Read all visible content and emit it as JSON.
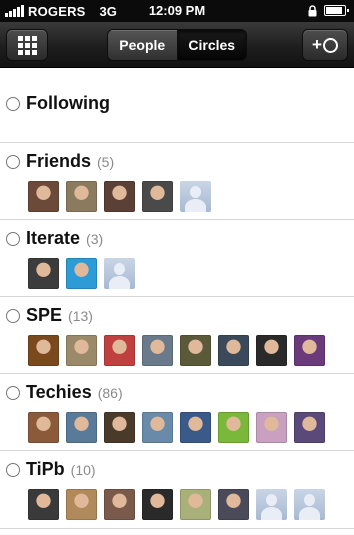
{
  "status_bar": {
    "carrier": "ROGERS",
    "network": "3G",
    "time": "12:09 PM"
  },
  "nav": {
    "segments": [
      "People",
      "Circles"
    ],
    "selected_segment": "Circles",
    "add_button": "+O"
  },
  "circles": [
    {
      "name": "Following",
      "count": "",
      "avatars": []
    },
    {
      "name": "Friends",
      "count": "(5)",
      "avatars": [
        "#6b4a3a",
        "#8a7a5e",
        "#5a4035",
        "#4a4a4a",
        "placeholder"
      ]
    },
    {
      "name": "Iterate",
      "count": "(3)",
      "avatars": [
        "#3c3c3c",
        "#2d9bd6",
        "placeholder"
      ]
    },
    {
      "name": "SPE",
      "count": "(13)",
      "avatars": [
        "#7a4a1e",
        "#9a8a6a",
        "#c04040",
        "#6a7a8a",
        "#5a5a3a",
        "#3a4a5a",
        "#2a2a2a",
        "#6a3a7a"
      ]
    },
    {
      "name": "Techies",
      "count": "(86)",
      "avatars": [
        "#8a5a3a",
        "#5a7a9a",
        "#4a3a2a",
        "#6a8aaa",
        "#3a5a8a",
        "#7ab83a",
        "#c9a0c0",
        "#5a4a7a"
      ]
    },
    {
      "name": "TiPb",
      "count": "(10)",
      "avatars": [
        "#3a3a3a",
        "#b08a5a",
        "#7a5a4a",
        "#2a2a2a",
        "#aab07a",
        "#4a4a5a",
        "placeholder",
        "placeholder"
      ]
    }
  ]
}
